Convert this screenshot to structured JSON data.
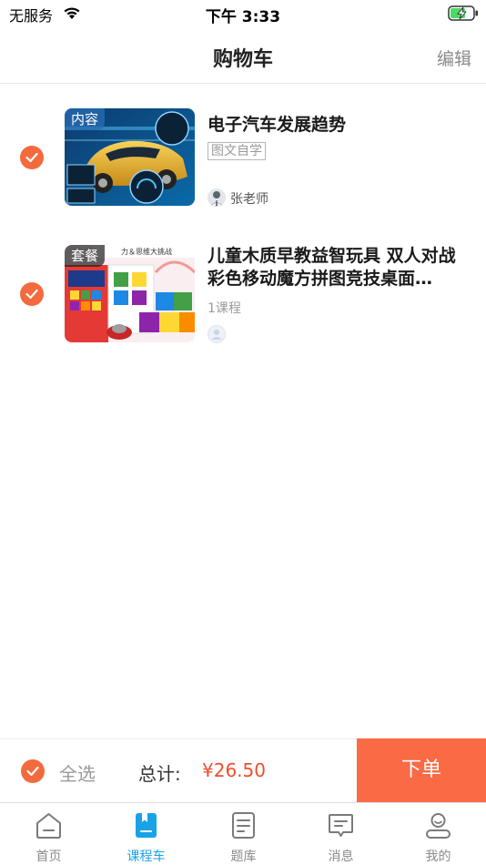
{
  "status_bar": {
    "carrier": "无服务",
    "time": "下午 3:33"
  },
  "nav": {
    "title": "购物车",
    "edit_label": "编辑"
  },
  "cart_items": [
    {
      "thumb_tag": "内容",
      "title": "电子汽车发展趋势",
      "badge": "图文自学",
      "teacher": "张老师",
      "checked": true
    },
    {
      "thumb_tag": "套餐",
      "title": "儿童木质早教益智玩具 双人对战彩色移动魔方拼图竞技桌面…",
      "meta": "1课程",
      "checked": true
    }
  ],
  "checkout": {
    "select_all_label": "全选",
    "total_label": "总计:",
    "total_value": "¥26.50",
    "order_label": "下单"
  },
  "tabs": [
    {
      "label": "首页",
      "icon": "home-icon",
      "active": false
    },
    {
      "label": "课程车",
      "icon": "course-cart-icon",
      "active": true
    },
    {
      "label": "题库",
      "icon": "question-bank-icon",
      "active": false
    },
    {
      "label": "消息",
      "icon": "message-icon",
      "active": false
    },
    {
      "label": "我的",
      "icon": "profile-icon",
      "active": false
    }
  ],
  "colors": {
    "accent": "#f26a3d",
    "order_button": "#fa6a45",
    "price": "#f04e2d",
    "tab_active": "#1aa2e6"
  }
}
